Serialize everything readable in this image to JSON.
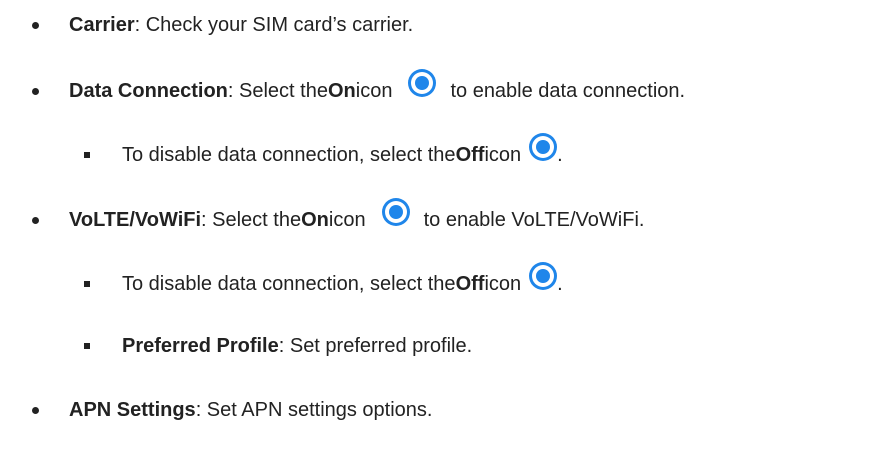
{
  "items": {
    "carrier": {
      "label": "Carrier",
      "text": ": Check your SIM card’s carrier."
    },
    "data_connection": {
      "label": "Data Connection",
      "text_pre": ": Select the ",
      "on": "On",
      "text_mid": " icon",
      "text_post": "to enable data connection.",
      "icon": "radio-on-icon",
      "sub": {
        "text_pre": "To disable data connection, select the ",
        "off": "Off",
        "text_mid": " icon",
        "text_post": ".",
        "icon": "radio-off-icon"
      }
    },
    "volte": {
      "label": "VoLTE/VoWiFi",
      "text_pre": ": Select the ",
      "on": "On",
      "text_mid": " icon",
      "text_post": "to enable VoLTE/VoWiFi.",
      "icon": "radio-on-icon",
      "sub1": {
        "text_pre": "To disable data connection, select the ",
        "off": "Off",
        "text_mid": " icon",
        "text_post": ".",
        "icon": "radio-off-icon"
      },
      "sub2": {
        "label": "Preferred Profile",
        "text": ": Set preferred profile."
      }
    },
    "apn": {
      "label": "APN Settings",
      "text": ": Set APN settings options."
    }
  },
  "colors": {
    "icon_blue": "#1f86ea",
    "text": "#222222"
  }
}
